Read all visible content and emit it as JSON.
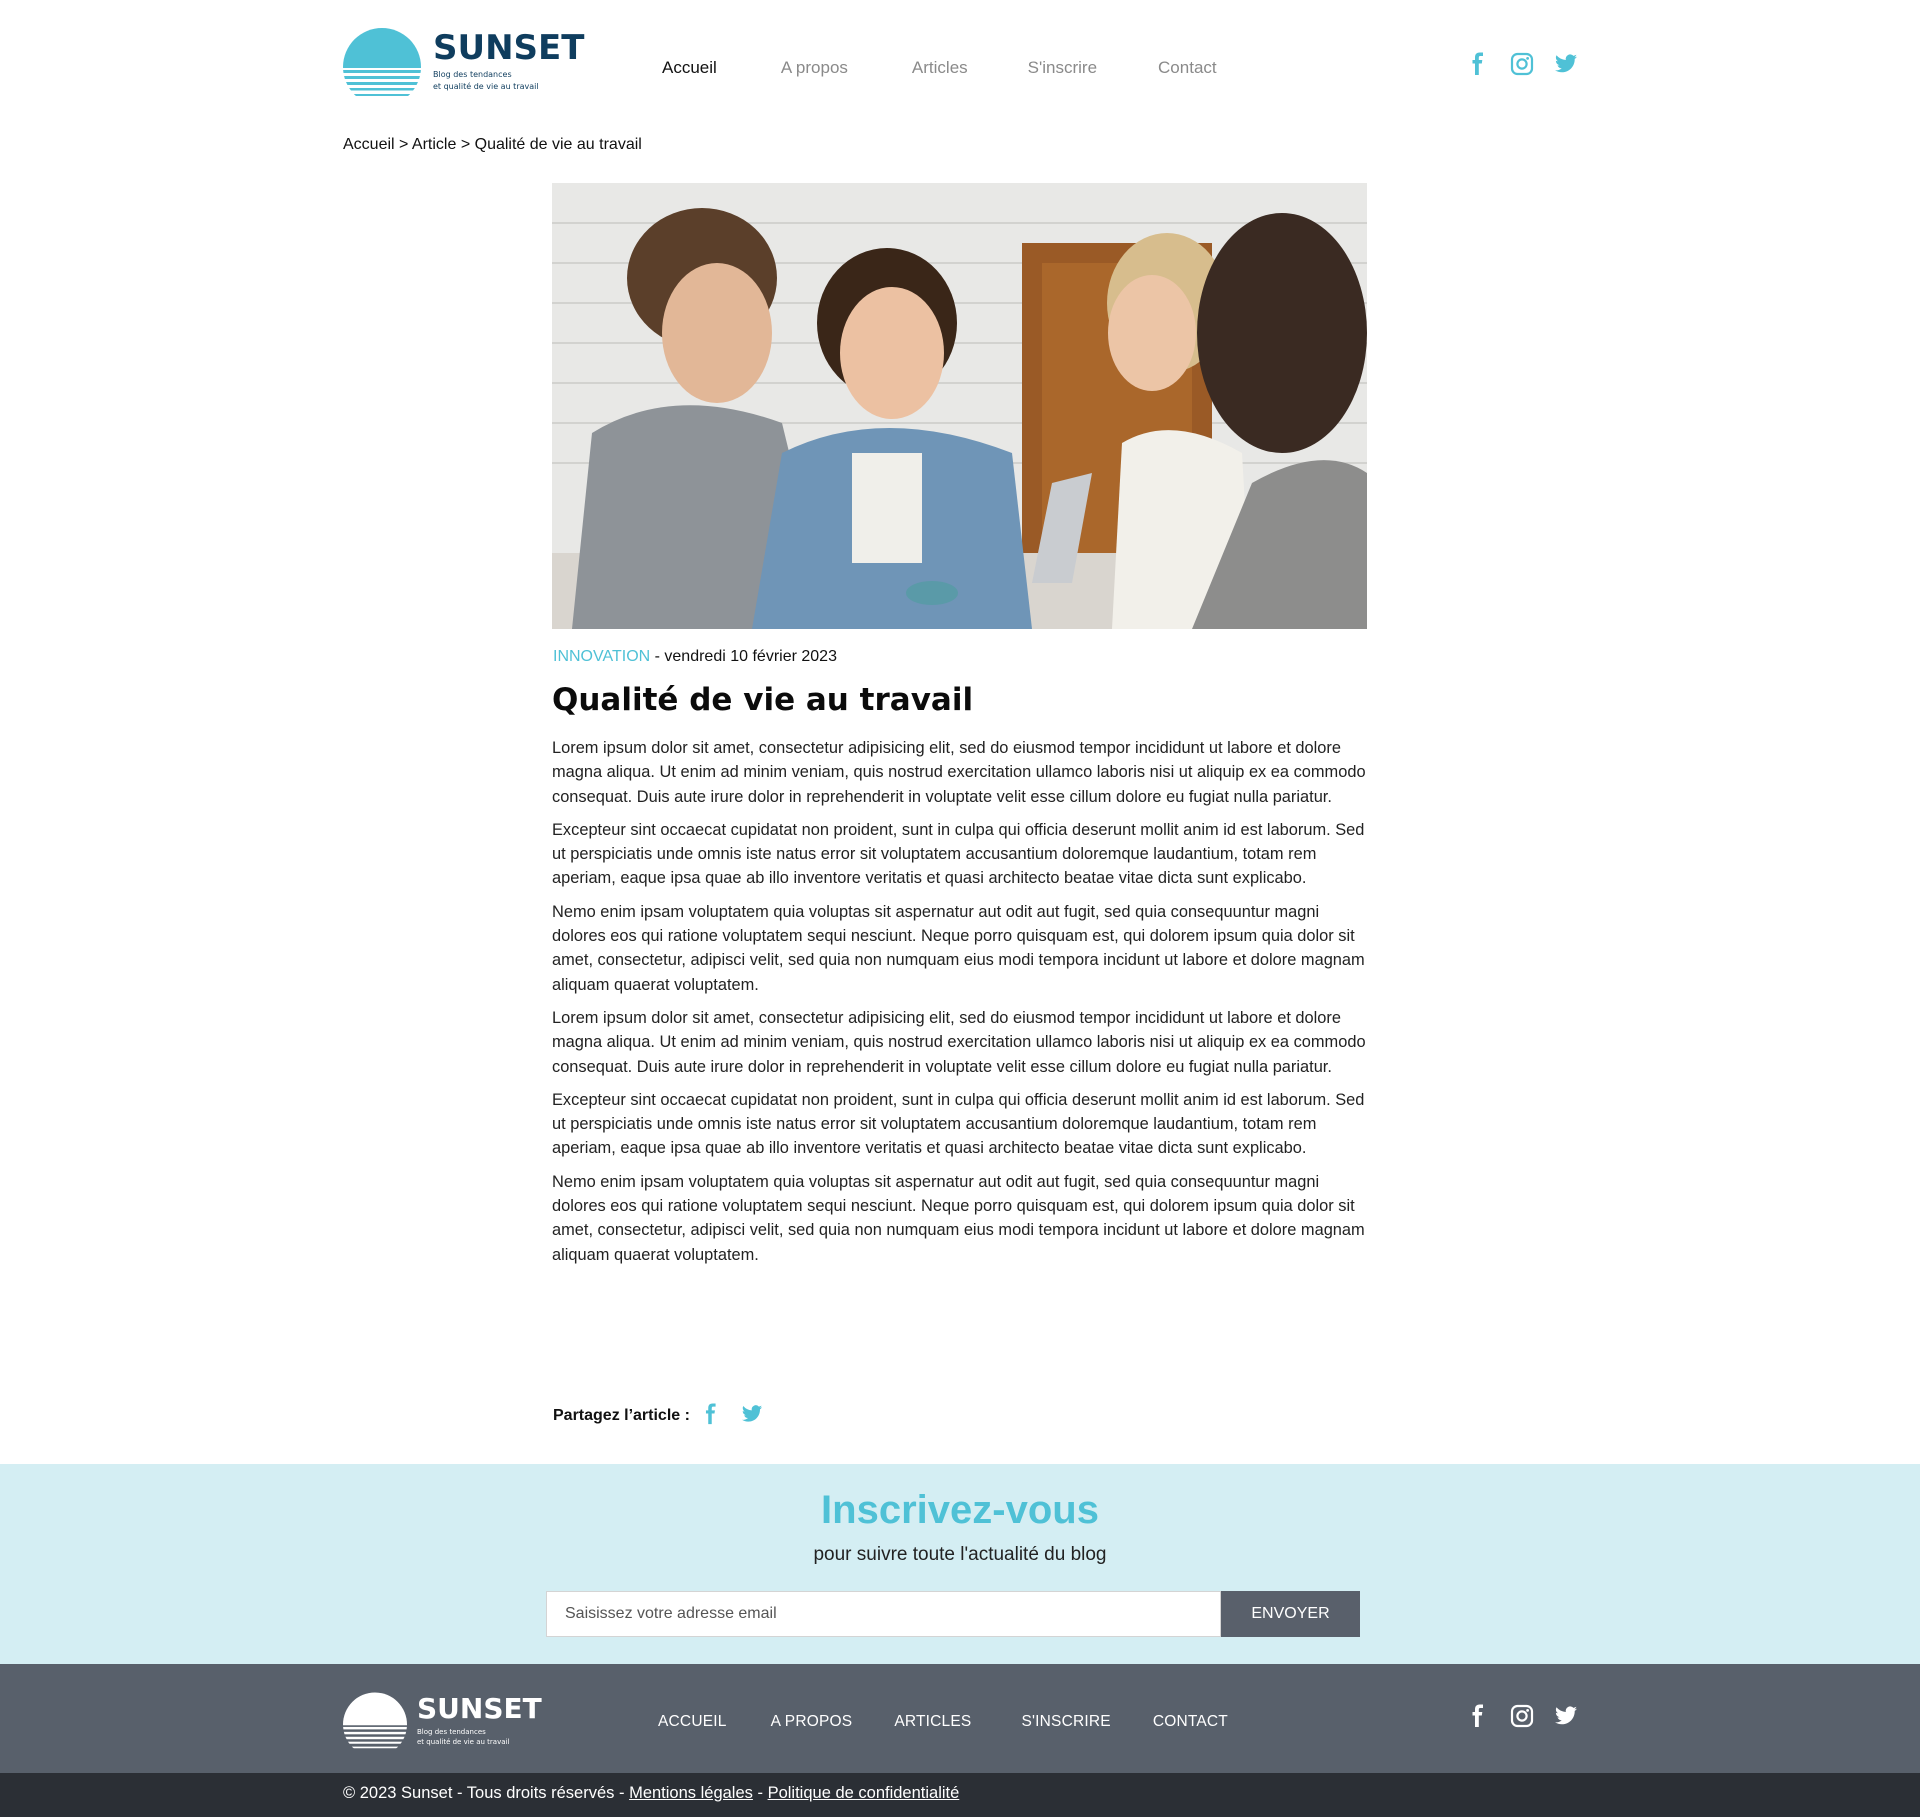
{
  "colors": {
    "accent": "#4fc1d6",
    "brand_dark": "#0f3d5e",
    "newsletter_bg": "#d4eef3",
    "footer_bg": "#58606b",
    "copyright_bg": "#2b2f35"
  },
  "header": {
    "logo": {
      "name": "SUNSET",
      "sub_line1": "Blog des tendances",
      "sub_line2": "et qualité de vie au travail"
    },
    "nav": [
      {
        "label": "Accueil",
        "active": true
      },
      {
        "label": "A propos",
        "active": false
      },
      {
        "label": "Articles",
        "active": false
      },
      {
        "label": "S'inscrire",
        "active": false
      },
      {
        "label": "Contact",
        "active": false
      }
    ],
    "social": [
      "facebook-icon",
      "instagram-icon",
      "twitter-icon"
    ]
  },
  "breadcrumb": "Accueil > Article > Qualité de vie au travail",
  "article": {
    "category": "INNOVATION",
    "date": " - vendredi 10 février 2023",
    "title": "Qualité de vie au travail",
    "paragraphs": [
      "Lorem ipsum dolor sit amet, consectetur adipisicing elit, sed do eiusmod tempor incididunt ut labore et dolore magna aliqua. Ut enim ad minim veniam, quis nostrud exercitation ullamco laboris nisi ut aliquip ex ea commodo consequat. Duis aute irure dolor in reprehenderit in voluptate velit esse cillum dolore eu fugiat nulla pariatur.",
      "Excepteur sint occaecat cupidatat non proident, sunt in culpa qui officia deserunt mollit anim id est laborum. Sed ut perspiciatis unde omnis iste natus error sit voluptatem accusantium doloremque laudantium, totam rem aperiam, eaque ipsa quae ab illo inventore veritatis et quasi architecto beatae vitae dicta sunt explicabo.",
      "Nemo enim ipsam voluptatem quia voluptas sit aspernatur aut odit aut fugit, sed quia consequuntur magni dolores eos qui ratione voluptatem sequi nesciunt. Neque porro quisquam est, qui dolorem ipsum quia dolor sit amet, consectetur, adipisci velit, sed quia non numquam eius modi tempora incidunt ut labore et dolore magnam aliquam quaerat voluptatem.",
      "Lorem ipsum dolor sit amet, consectetur adipisicing elit, sed do eiusmod tempor incididunt ut labore et dolore magna aliqua. Ut enim ad minim veniam, quis nostrud exercitation ullamco laboris nisi ut aliquip ex ea commodo consequat. Duis aute irure dolor in reprehenderit in voluptate velit esse cillum dolore eu fugiat nulla pariatur.",
      "Excepteur sint occaecat cupidatat non proident, sunt in culpa qui officia deserunt mollit anim id est laborum. Sed ut perspiciatis unde omnis iste natus error sit voluptatem accusantium doloremque laudantium, totam rem aperiam, eaque ipsa quae ab illo inventore veritatis et quasi architecto beatae vitae dicta sunt explicabo.",
      "Nemo enim ipsam voluptatem quia voluptas sit aspernatur aut odit aut fugit, sed quia consequuntur magni dolores eos qui ratione voluptatem sequi nesciunt. Neque porro quisquam est, qui dolorem ipsum quia dolor sit amet, consectetur, adipisci velit, sed quia non numquam eius modi tempora incidunt ut labore et dolore magnam aliquam quaerat voluptatem."
    ],
    "share_label": "Partagez l’article :",
    "share_icons": [
      "facebook-icon",
      "twitter-icon"
    ]
  },
  "newsletter": {
    "title": "Inscrivez-vous",
    "subtitle": "pour suivre toute l'actualité du blog",
    "email_placeholder": "Saisissez votre adresse email",
    "button": "ENVOYER"
  },
  "footer": {
    "logo": {
      "name": "SUNSET",
      "sub_line1": "Blog des tendances",
      "sub_line2": "et qualité de vie au travail"
    },
    "nav": [
      "ACCUEIL",
      "A PROPOS",
      "ARTICLES",
      "S'INSCRIRE",
      "CONTACT"
    ],
    "social": [
      "facebook-icon",
      "instagram-icon",
      "twitter-icon"
    ],
    "copyright_prefix": "© 2023 Sunset - Tous droits réservés - ",
    "legal_link": "Mentions légales",
    "separator": " - ",
    "privacy_link": "Politique de confidentialité"
  }
}
